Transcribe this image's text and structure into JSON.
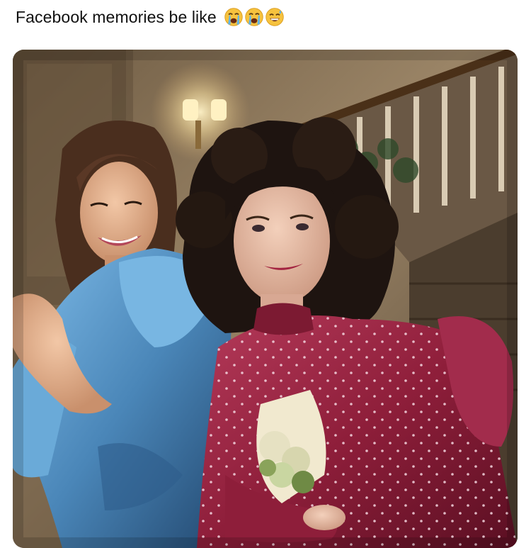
{
  "post": {
    "caption": "Facebook memories be like",
    "emojis": [
      "loudly-crying-face-icon",
      "loudly-crying-face-icon",
      "grinning-sweat-face-icon"
    ]
  },
  "photo": {
    "subject": "two women in 1980s prom dresses posing on a staircase",
    "colors": {
      "wall": "#8c7658",
      "blue_dress": "#4a86b8",
      "red_dress": "#8e1e3a",
      "hair": "#1e1410"
    }
  }
}
